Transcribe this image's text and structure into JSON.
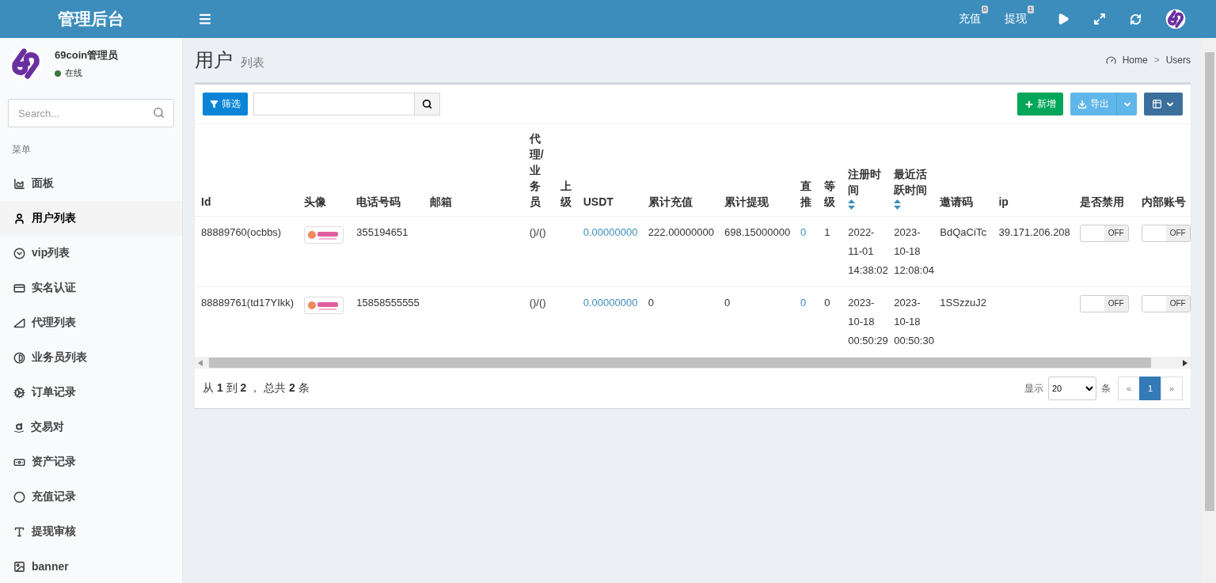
{
  "header": {
    "title": "管理后台",
    "nav": [
      {
        "label": "充值",
        "badge": "0"
      },
      {
        "label": "提现",
        "badge": "1"
      }
    ]
  },
  "sidebar": {
    "user": {
      "name": "69coin管理员",
      "status": "在线"
    },
    "search": {
      "placeholder": "Search..."
    },
    "section": "菜单",
    "items": [
      {
        "label": "面板",
        "selected": false
      },
      {
        "label": "用户列表",
        "selected": true
      },
      {
        "label": "vip列表",
        "selected": false
      },
      {
        "label": "实名认证",
        "selected": false
      },
      {
        "label": "代理列表",
        "selected": false
      },
      {
        "label": "业务员列表",
        "selected": false
      },
      {
        "label": "订单记录",
        "selected": false
      },
      {
        "label": "交易对",
        "selected": false
      },
      {
        "label": "资产记录",
        "selected": false
      },
      {
        "label": "充值记录",
        "selected": false
      },
      {
        "label": "提现审核",
        "selected": false
      },
      {
        "label": "banner",
        "selected": false
      }
    ]
  },
  "page": {
    "title": "用户",
    "subtitle": "列表",
    "breadcrumb": [
      "Home",
      "Users"
    ],
    "separator": ">"
  },
  "toolbar": {
    "filter": "筛选",
    "add": "新增",
    "export": "导出"
  },
  "table": {
    "columns": [
      {
        "label": "Id"
      },
      {
        "label": "头像"
      },
      {
        "label": "电话号码"
      },
      {
        "label": "邮箱"
      },
      {
        "label": "代理/业务员"
      },
      {
        "label": "上级"
      },
      {
        "label": "USDT"
      },
      {
        "label": "累计充值"
      },
      {
        "label": "累计提现"
      },
      {
        "label": "直推"
      },
      {
        "label": "等级"
      },
      {
        "label": "注册时间",
        "sortable": true
      },
      {
        "label": "最近活跃时间",
        "sortable": true
      },
      {
        "label": "邀请码"
      },
      {
        "label": "ip"
      },
      {
        "label": "是否禁用"
      },
      {
        "label": "内部账号"
      }
    ],
    "rows": [
      {
        "id": "88889760(ocbbs)",
        "phone": "355194651",
        "agent": "()/()",
        "usdt": "0.00000000",
        "recharge": "222.00000000",
        "withdraw": "698.15000000",
        "direct": "0",
        "level": "1",
        "registered": "2022-11-01 14:38:02",
        "active": "2023-10-18 12:08:04",
        "invite": "BdQaCiTc",
        "ip": "39.171.206.208",
        "disabled": {
          "label": "OFF",
          "checked": false
        },
        "internal": {
          "label": "OFF",
          "checked": false
        }
      },
      {
        "id": "88889761(td17YIkk)",
        "phone": "15858555555",
        "agent": "()/()",
        "usdt": "0.00000000",
        "recharge": "0",
        "withdraw": "0",
        "direct": "0",
        "level": "0",
        "registered": "2023-10-18 00:50:29",
        "active": "2023-10-18 00:50:30",
        "invite": "1SSzzuJ2",
        "disabled": {
          "label": "OFF",
          "checked": false
        },
        "internal": {
          "label": "OFF",
          "checked": false
        }
      }
    ]
  },
  "footer": {
    "summary": "从 **1** 到 **2** ， 总共 **2** 条",
    "show": "显示",
    "page_size": "20",
    "unit": "条",
    "pages": [
      {
        "label": "«",
        "selected": false
      },
      {
        "label": "1",
        "selected": true
      },
      {
        "label": "»",
        "selected": false
      }
    ]
  }
}
